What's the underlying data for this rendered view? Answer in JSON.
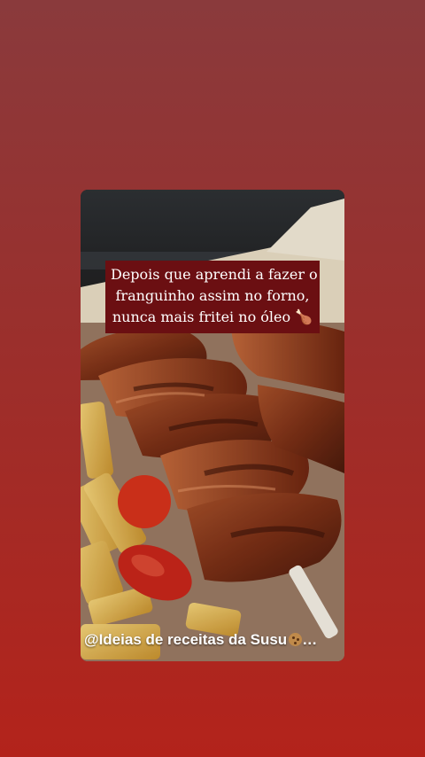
{
  "story": {
    "caption_lines": [
      "Depois que aprendi a fazer o",
      "franguinho assim no forno,",
      "nunca mais fritei no óleo 🍗"
    ],
    "watermark_text": "@Ideias de receitas da Susu",
    "watermark_trailing": "…",
    "watermark_icon": "cookie-icon"
  },
  "colors": {
    "caption_bg": "#6b0f12",
    "page_top": "#8a3a3c",
    "page_bottom": "#b3231b"
  }
}
